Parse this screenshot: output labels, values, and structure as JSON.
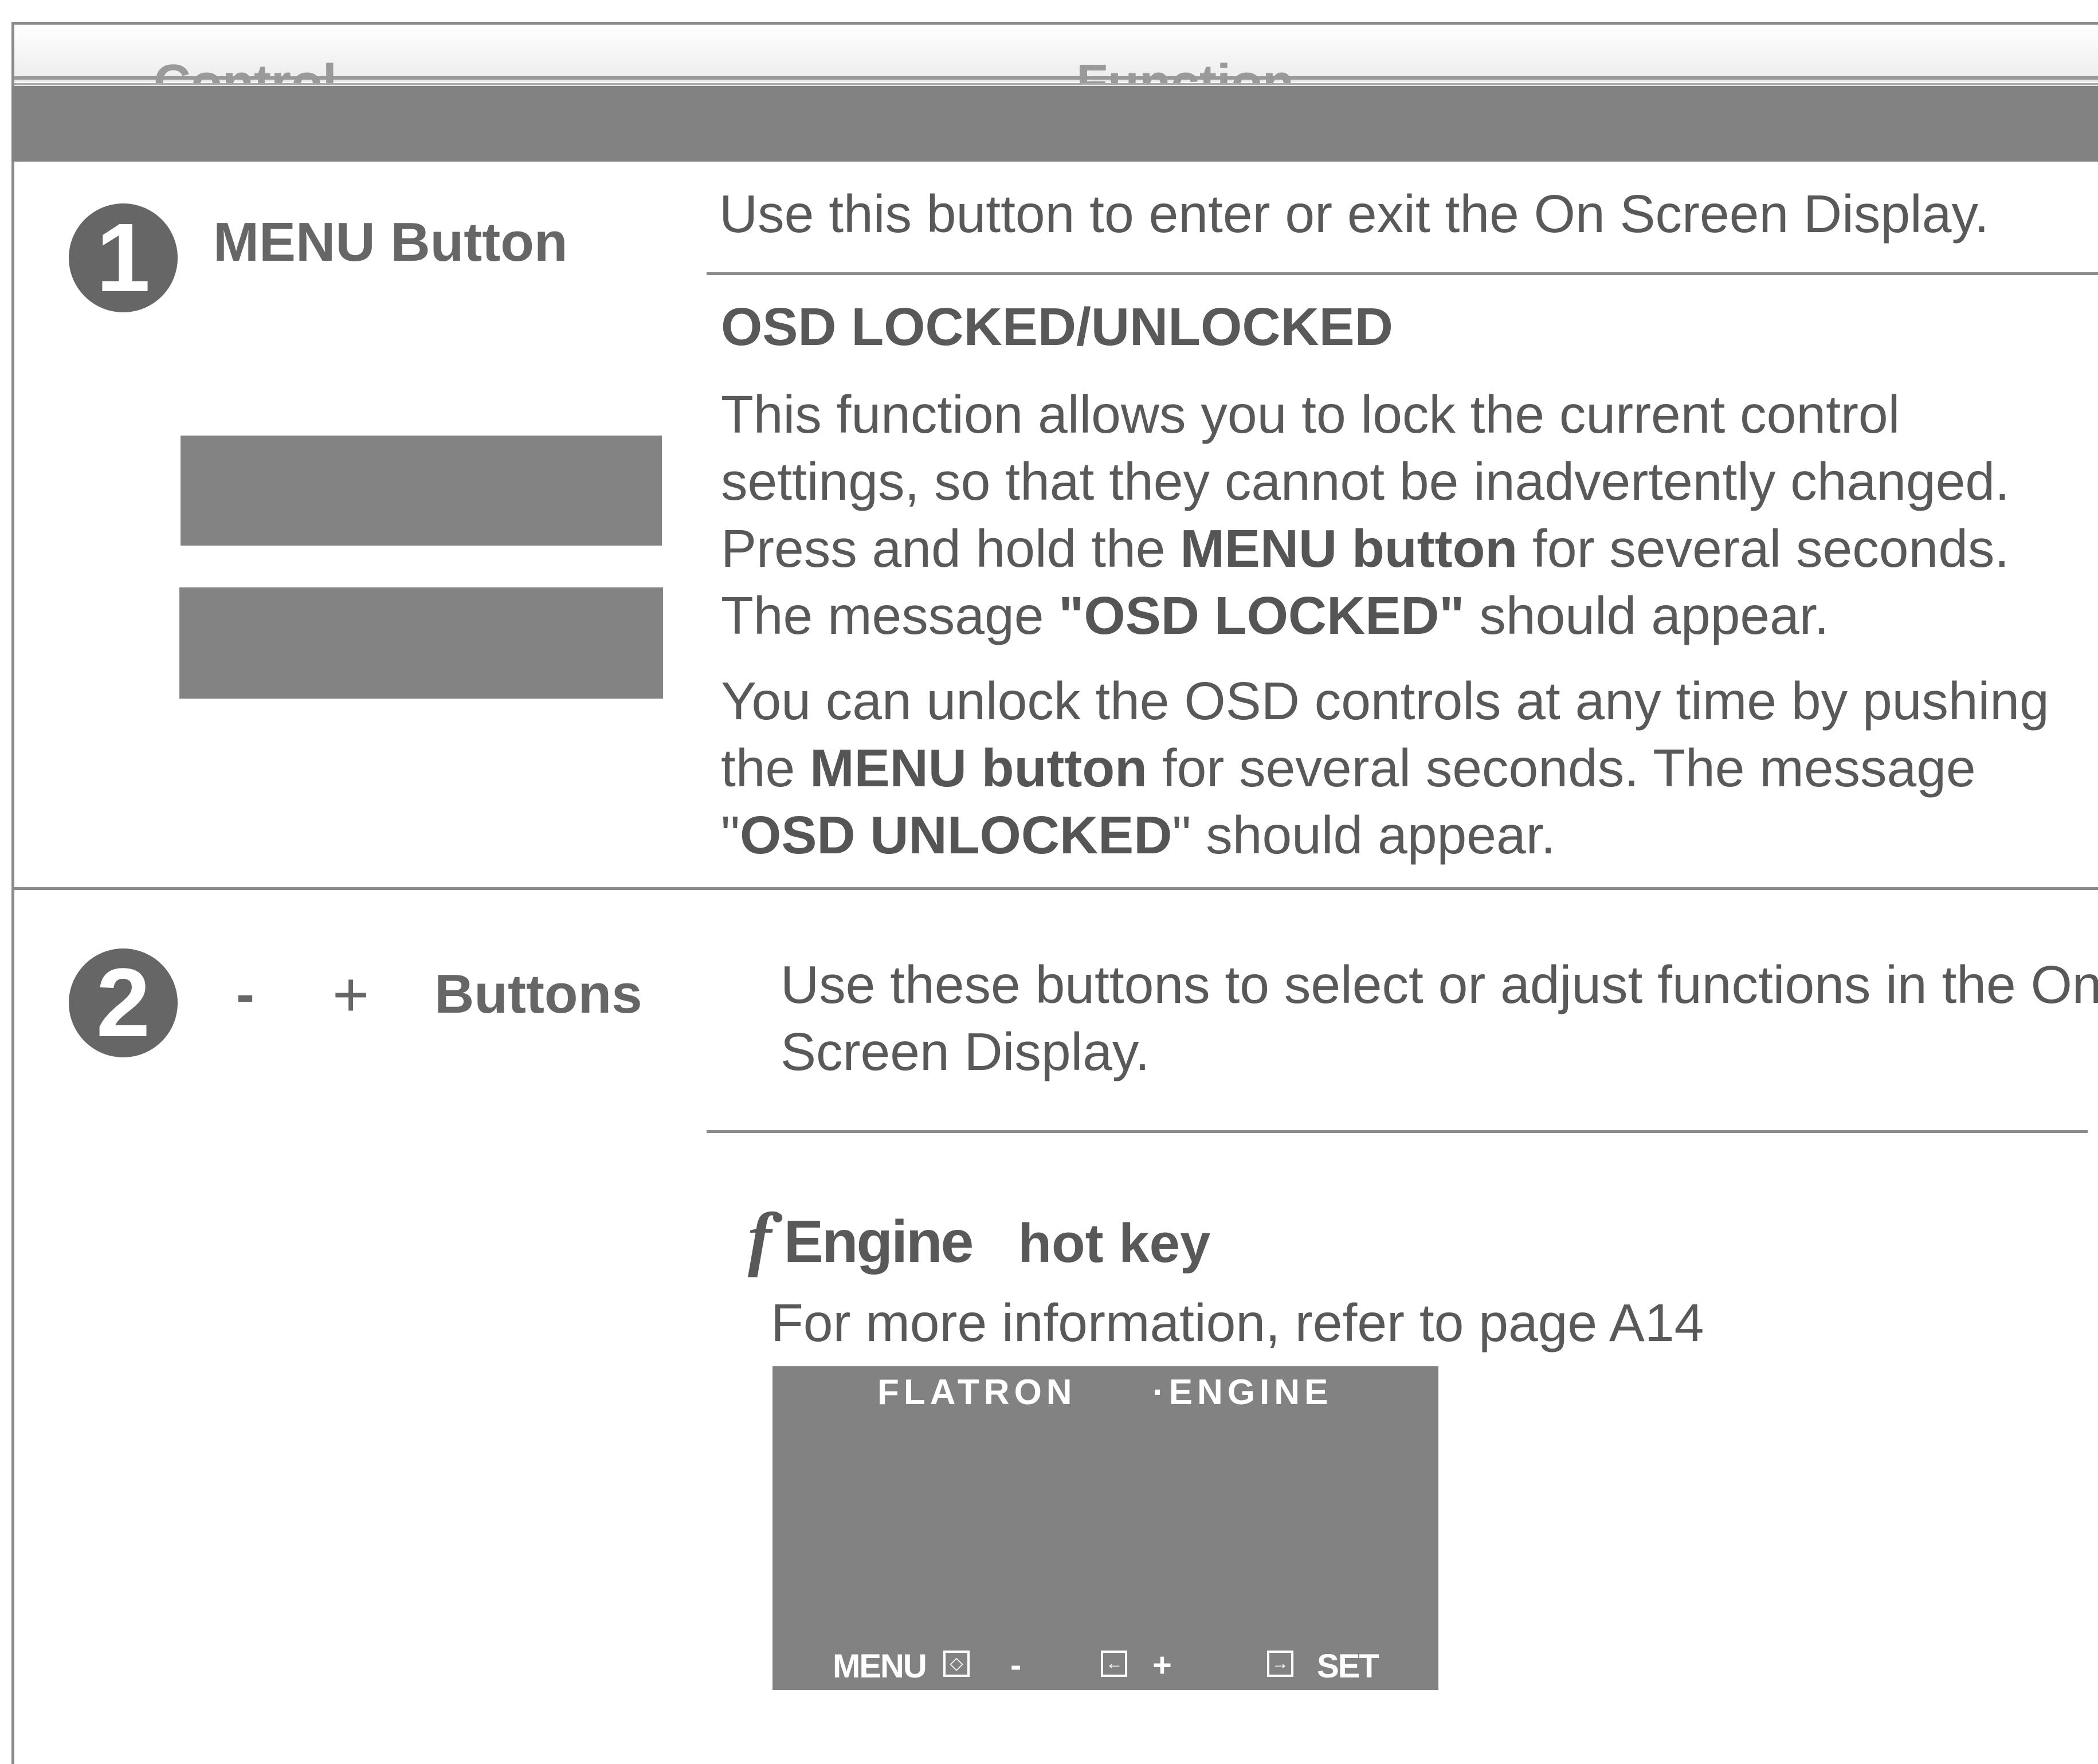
{
  "header": {
    "control_label": "Control",
    "function_label": "Function"
  },
  "rows": [
    {
      "number": "1",
      "control": "MENU Button",
      "function_intro": "Use this button to enter or exit the On Screen Display.",
      "subheading": "OSD LOCKED/UNLOCKED",
      "paragraph1": {
        "line1": "This function allows you to lock the current control",
        "line2": "settings, so that they cannot be inadvertently changed.",
        "line3_pre": "Press and hold the ",
        "line3_bold": "MENU button",
        "line3_post": " for several seconds.",
        "line4_pre": "The message ",
        "line4_bold": "\"OSD LOCKED\"",
        "line4_post": " should appear."
      },
      "paragraph2": {
        "line1": "You can unlock the OSD controls at any time by pushing",
        "line2_pre": "the ",
        "line2_bold": "MENU button",
        "line2_post": " for several seconds. The message",
        "line3_q1": "\"",
        "line3_bold": "OSD UNLOCKED",
        "line3_q2": "\"",
        "line3_post": " should appear."
      }
    },
    {
      "number": "2",
      "minus": "-",
      "plus": "+",
      "control": "Buttons",
      "function_line1": "Use these buttons to select or adjust functions in the On",
      "function_line2": "Screen Display.",
      "hotkey": {
        "f_symbol": "f",
        "engine": "Engine",
        "hot_key": "hot key",
        "info": "For more information, refer to page A14"
      },
      "osd": {
        "title_left": "FLATRON",
        "title_right": "·ENGINE",
        "menu": "MENU",
        "minus": "-",
        "plus": "+",
        "set": "SET"
      }
    }
  ]
}
